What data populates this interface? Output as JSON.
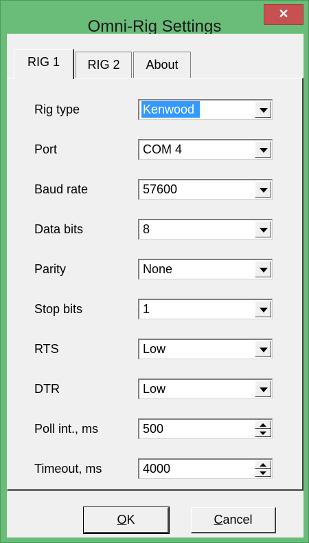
{
  "window": {
    "title": "Omni-Rig Settings",
    "close_glyph": "✕"
  },
  "tabs": [
    {
      "label": "RIG 1",
      "active": true
    },
    {
      "label": "RIG 2",
      "active": false
    },
    {
      "label": "About",
      "active": false
    }
  ],
  "settings": {
    "rig_type": {
      "label": "Rig type",
      "value": "Kenwood"
    },
    "port": {
      "label": "Port",
      "value": "COM 4"
    },
    "baud_rate": {
      "label": "Baud rate",
      "value": "57600"
    },
    "data_bits": {
      "label": "Data bits",
      "value": "8"
    },
    "parity": {
      "label": "Parity",
      "value": "None"
    },
    "stop_bits": {
      "label": "Stop bits",
      "value": "1"
    },
    "rts": {
      "label": "RTS",
      "value": "Low"
    },
    "dtr": {
      "label": "DTR",
      "value": "Low"
    },
    "poll_int": {
      "label": "Poll int., ms",
      "value": "500"
    },
    "timeout": {
      "label": "Timeout, ms",
      "value": "4000"
    }
  },
  "buttons": {
    "ok": {
      "mnemonic": "O",
      "rest": "K"
    },
    "cancel": {
      "mnemonic": "C",
      "rest": "ancel"
    }
  },
  "colors": {
    "title_bar": "#69bd78",
    "close_button": "#c75050",
    "selection": "#3399ff"
  }
}
